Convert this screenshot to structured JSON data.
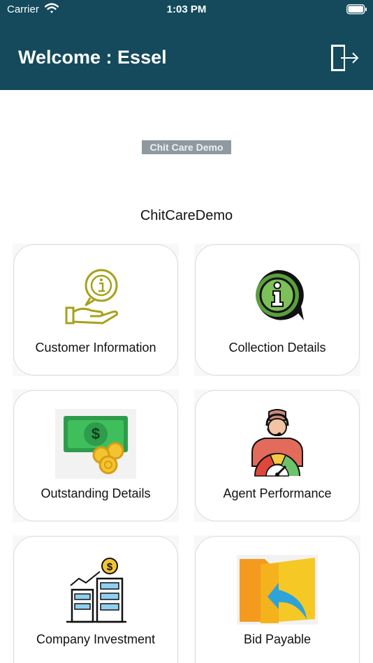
{
  "status_bar": {
    "carrier": "Carrier",
    "time": "1:03 PM"
  },
  "header": {
    "title": "Welcome : Essel",
    "logout_icon": "logout-icon"
  },
  "logo": {
    "text": "Chit Care Demo"
  },
  "company_name": "ChitCareDemo",
  "menu": [
    {
      "label": "Customer Information",
      "icon": "hand-info-icon"
    },
    {
      "label": "Collection Details",
      "icon": "info-bubble-icon"
    },
    {
      "label": "Outstanding Details",
      "icon": "money-coins-icon"
    },
    {
      "label": "Agent Performance",
      "icon": "agent-gauge-icon"
    },
    {
      "label": "Company Investment",
      "icon": "buildings-investment-icon"
    },
    {
      "label": "Bid Payable",
      "icon": "folder-return-icon"
    }
  ],
  "colors": {
    "header_bg": "#144a5c",
    "accent_green": "#5aa03c",
    "olive": "#a7a11b"
  }
}
